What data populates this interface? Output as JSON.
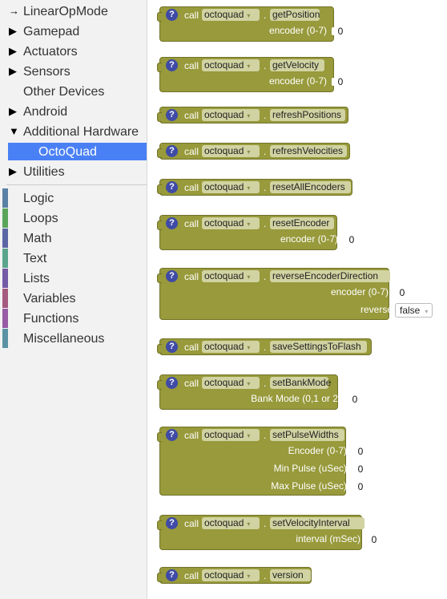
{
  "sidebar": {
    "categories": [
      {
        "label": "LinearOpMode",
        "arrow": "→"
      },
      {
        "label": "Gamepad",
        "arrow": "▶"
      },
      {
        "label": "Actuators",
        "arrow": "▶"
      },
      {
        "label": "Sensors",
        "arrow": "▶"
      },
      {
        "label": "Other Devices",
        "arrow": ""
      },
      {
        "label": "Android",
        "arrow": "▶"
      },
      {
        "label": "Additional Hardware",
        "arrow": "▼"
      },
      {
        "label": "OctoQuad",
        "arrow": ""
      },
      {
        "label": "Utilities",
        "arrow": "▶"
      }
    ],
    "builtins": [
      {
        "label": "Logic",
        "color": "#5b80a5"
      },
      {
        "label": "Loops",
        "color": "#5ba55b"
      },
      {
        "label": "Math",
        "color": "#5b67a5"
      },
      {
        "label": "Text",
        "color": "#5ba58c"
      },
      {
        "label": "Lists",
        "color": "#745ba5"
      },
      {
        "label": "Variables",
        "color": "#a55b80"
      },
      {
        "label": "Functions",
        "color": "#995ba5"
      },
      {
        "label": "Miscellaneous",
        "color": "#5b93a5"
      }
    ]
  },
  "common": {
    "call": "call",
    "device": "octoquad",
    "dot": ".",
    "help": "?",
    "dropdown_arrow": "▾"
  },
  "blocks": [
    {
      "method": "getPosition",
      "params": [
        {
          "label": "encoder (0-7)",
          "value": "0"
        }
      ]
    },
    {
      "method": "getVelocity",
      "params": [
        {
          "label": "encoder (0-7)",
          "value": "0"
        }
      ]
    },
    {
      "method": "refreshPositions",
      "params": []
    },
    {
      "method": "refreshVelocities",
      "params": []
    },
    {
      "method": "resetAllEncoders",
      "params": []
    },
    {
      "method": "resetEncoder",
      "params": [
        {
          "label": "encoder (0-7)",
          "value": "0"
        }
      ]
    },
    {
      "method": "reverseEncoderDirection",
      "params": [
        {
          "label": "encoder (0-7)",
          "value": "0"
        },
        {
          "label": "reverse",
          "value": "false",
          "dropdown": true
        }
      ]
    },
    {
      "method": "saveSettingsToFlash",
      "params": []
    },
    {
      "method": "setBankMode",
      "params": [
        {
          "label": "Bank Mode (0,1 or 2)",
          "value": "0"
        }
      ]
    },
    {
      "method": "setPulseWidths",
      "params": [
        {
          "label": "Encoder (0-7)",
          "value": "0"
        },
        {
          "label": "Min Pulse (uSec)",
          "value": "0"
        },
        {
          "label": "Max Pulse (uSec)",
          "value": "0"
        }
      ]
    },
    {
      "method": "setVelocityInterval",
      "params": [
        {
          "label": "interval (mSec)",
          "value": "0"
        }
      ]
    },
    {
      "method": "version",
      "params": []
    }
  ]
}
